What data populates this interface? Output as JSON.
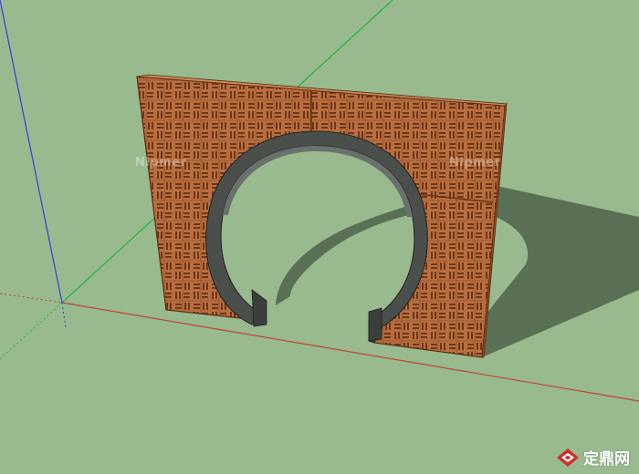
{
  "viewport": {
    "background_color": "#98ba8e",
    "axes": {
      "red_color": "#c0433a",
      "green_color": "#24b33c",
      "blue_color": "#3a3adf"
    }
  },
  "model": {
    "name": "moon-gate-lattice-wall",
    "wood_color": "#b96e3f",
    "slat_color": "#7a3e1c",
    "arch_frame_color": "#4a4f4c",
    "shadow_color": "#556a52"
  },
  "watermarks": [
    "Nipmer",
    "Nipmer"
  ],
  "brand": {
    "text": "定鼎网",
    "logo_icon": "diamond-logo-icon"
  }
}
